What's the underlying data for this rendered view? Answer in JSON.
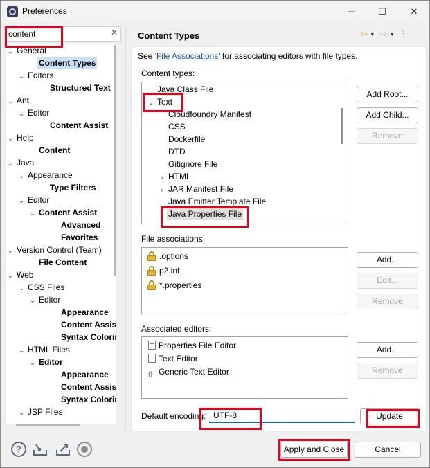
{
  "window": {
    "title": "Preferences",
    "minimize": "─",
    "maximize": "☐",
    "close": "✕"
  },
  "filter": {
    "value": "content",
    "clear": "✕"
  },
  "tree": [
    {
      "label": "General",
      "indent": 0,
      "twisty": "⌄"
    },
    {
      "label": "Content Types",
      "indent": 2,
      "twisty": "",
      "bold": true,
      "selected": true
    },
    {
      "label": "Editors",
      "indent": 1,
      "twisty": "⌄"
    },
    {
      "label": "Structured Text",
      "indent": 3,
      "twisty": "",
      "bold": true
    },
    {
      "label": "Ant",
      "indent": 0,
      "twisty": "⌄"
    },
    {
      "label": "Editor",
      "indent": 1,
      "twisty": "⌄"
    },
    {
      "label": "Content Assist",
      "indent": 3,
      "twisty": "",
      "bold": true
    },
    {
      "label": "Help",
      "indent": 0,
      "twisty": "⌄"
    },
    {
      "label": "Content",
      "indent": 2,
      "twisty": "",
      "bold": true
    },
    {
      "label": "Java",
      "indent": 0,
      "twisty": "⌄"
    },
    {
      "label": "Appearance",
      "indent": 1,
      "twisty": "⌄"
    },
    {
      "label": "Type Filters",
      "indent": 3,
      "twisty": "",
      "bold": true
    },
    {
      "label": "Editor",
      "indent": 1,
      "twisty": "⌄"
    },
    {
      "label": "Content Assist",
      "indent": 2,
      "twisty": "⌄",
      "bold": true
    },
    {
      "label": "Advanced",
      "indent": 4,
      "twisty": "",
      "bold": true
    },
    {
      "label": "Favorites",
      "indent": 4,
      "twisty": "",
      "bold": true
    },
    {
      "label": "Version Control (Team)",
      "indent": 0,
      "twisty": "⌄"
    },
    {
      "label": "File Content",
      "indent": 2,
      "twisty": "",
      "bold": true
    },
    {
      "label": "Web",
      "indent": 0,
      "twisty": "⌄"
    },
    {
      "label": "CSS Files",
      "indent": 1,
      "twisty": "⌄"
    },
    {
      "label": "Editor",
      "indent": 2,
      "twisty": "⌄"
    },
    {
      "label": "Appearance",
      "indent": 4,
      "twisty": "",
      "bold": true
    },
    {
      "label": "Content Assist",
      "indent": 4,
      "twisty": "",
      "bold": true
    },
    {
      "label": "Syntax Coloring",
      "indent": 4,
      "twisty": "",
      "bold": true
    },
    {
      "label": "HTML Files",
      "indent": 1,
      "twisty": "⌄"
    },
    {
      "label": "Editor",
      "indent": 2,
      "twisty": "⌄",
      "bold": true
    },
    {
      "label": "Appearance",
      "indent": 4,
      "twisty": "",
      "bold": true
    },
    {
      "label": "Content Assist",
      "indent": 4,
      "twisty": "",
      "bold": true
    },
    {
      "label": "Syntax Coloring",
      "indent": 4,
      "twisty": "",
      "bold": true
    },
    {
      "label": "JSP Files",
      "indent": 1,
      "twisty": "⌄"
    }
  ],
  "page": {
    "title": "Content Types",
    "hint_prefix": "See ",
    "hint_link": "'File Associations'",
    "hint_suffix": " for associating editors with file types.",
    "nav": {
      "back": "⇦",
      "dropdown": "▼",
      "forward": "⇨",
      "menu": "⋮"
    }
  },
  "content_types": {
    "label": "Content types:",
    "items": [
      {
        "label": "Java Class File",
        "indent": 0,
        "twisty": ""
      },
      {
        "label": "Text",
        "indent": 0,
        "twisty": "⌄"
      },
      {
        "label": "Cloudfoundry Manifest",
        "indent": 1,
        "twisty": ""
      },
      {
        "label": "CSS",
        "indent": 1,
        "twisty": ""
      },
      {
        "label": "Dockerfile",
        "indent": 1,
        "twisty": ""
      },
      {
        "label": "DTD",
        "indent": 1,
        "twisty": ""
      },
      {
        "label": "Gitignore File",
        "indent": 1,
        "twisty": ""
      },
      {
        "label": "HTML",
        "indent": 1,
        "twisty": "›"
      },
      {
        "label": "JAR Manifest File",
        "indent": 1,
        "twisty": "›"
      },
      {
        "label": "Java Emitter Template File",
        "indent": 1,
        "twisty": ""
      },
      {
        "label": "Java Properties File",
        "indent": 1,
        "twisty": "",
        "selected": true
      }
    ],
    "buttons": {
      "add_root": "Add Root...",
      "add_child": "Add Child...",
      "remove": "Remove"
    }
  },
  "file_associations": {
    "label": "File associations:",
    "items": [
      ".options",
      "p2.inf",
      "*.properties"
    ],
    "buttons": {
      "add": "Add...",
      "edit": "Edit...",
      "remove": "Remove"
    }
  },
  "associated_editors": {
    "label": "Associated editors:",
    "items": [
      {
        "label": "Properties File Editor",
        "icon": "document-icon"
      },
      {
        "label": "Text Editor",
        "icon": "document-icon"
      },
      {
        "label": "Generic Text Editor",
        "icon": "text-document-icon",
        "glyph": "{}"
      }
    ],
    "buttons": {
      "add": "Add...",
      "remove": "Remove"
    }
  },
  "encoding": {
    "label": "Default encoding:",
    "value": "UTF-8",
    "update": "Update"
  },
  "footer": {
    "help": "?",
    "apply_close": "Apply and Close",
    "cancel": "Cancel"
  },
  "highlight_color": "#e8001c",
  "accent": "#1565c0"
}
